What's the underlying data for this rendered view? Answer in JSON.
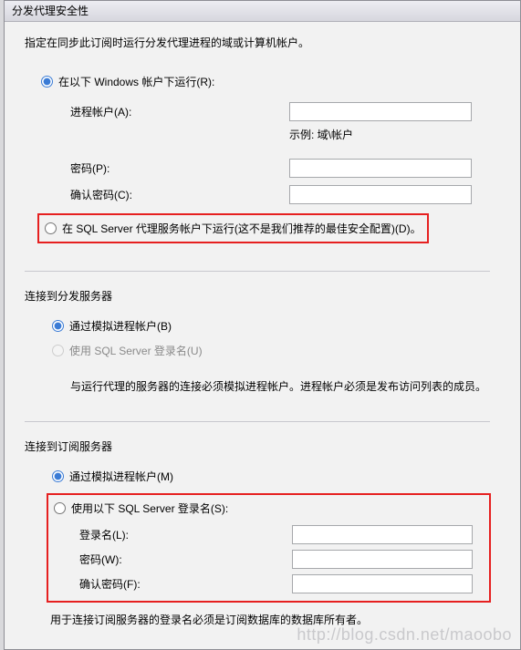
{
  "titlebar": "分发代理安全性",
  "intro": "指定在同步此订阅时运行分发代理进程的域或计算机帐户。",
  "section1": {
    "radio_windows_label": "在以下 Windows 帐户下运行(R):",
    "process_account_label": "进程帐户(A):",
    "example_text": "示例: 域\\帐户",
    "password_label": "密码(P):",
    "confirm_password_label": "确认密码(C):",
    "radio_sqlagent_label": "在 SQL Server 代理服务帐户下运行(这不是我们推荐的最佳安全配置)(D)。"
  },
  "section2": {
    "title": "连接到分发服务器",
    "radio_impersonate_label": "通过模拟进程帐户(B)",
    "radio_sqllogin_label": "使用 SQL Server 登录名(U)",
    "note": "与运行代理的服务器的连接必须模拟进程帐户。进程帐户必须是发布访问列表的成员。"
  },
  "section3": {
    "title": "连接到订阅服务器",
    "radio_impersonate_label": "通过模拟进程帐户(M)",
    "radio_sqllogin_label": "使用以下 SQL Server 登录名(S):",
    "login_label": "登录名(L):",
    "password_label": "密码(W):",
    "confirm_password_label": "确认密码(F):",
    "footer_note": "用于连接订阅服务器的登录名必须是订阅数据库的数据库所有者。"
  },
  "watermark": "http://blog.csdn.net/maoobo"
}
